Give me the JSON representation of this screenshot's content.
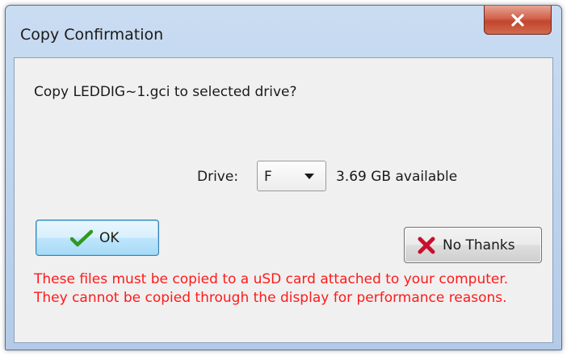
{
  "window": {
    "title": "Copy Confirmation",
    "close_icon": "close-icon"
  },
  "dialog": {
    "question": "Copy LEDDIG~1.gci to selected drive?",
    "drive_label": "Drive:",
    "drive_value": "F",
    "available": "3.69 GB available",
    "warning": "These files must be copied to a uSD card attached to your computer. They cannot be copied through the display for performance reasons."
  },
  "buttons": {
    "ok_label": "OK",
    "ok_icon": "checkmark-icon",
    "no_thanks_label": "No Thanks",
    "no_thanks_icon": "red-x-icon"
  },
  "colors": {
    "warning_text": "#ff1a1a",
    "checkmark": "#2e9a1e",
    "cross": "#c8102e",
    "close_button": "#c3452d"
  }
}
